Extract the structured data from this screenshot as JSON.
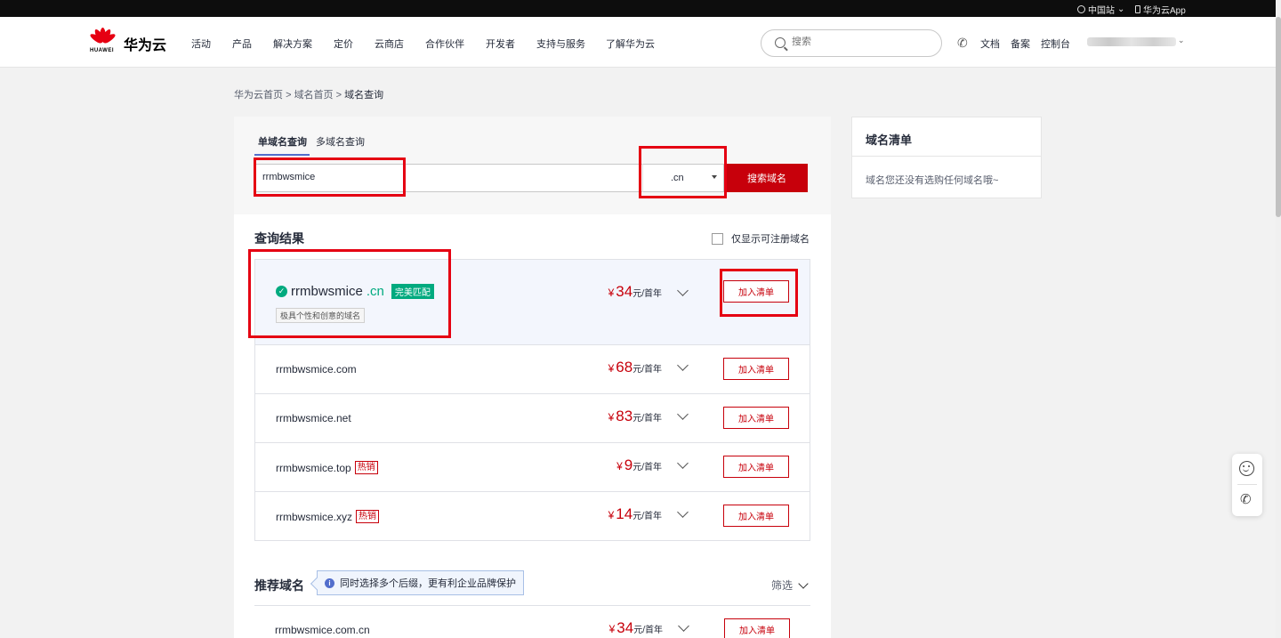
{
  "topbar": {
    "region": "中国站",
    "app": "华为云App"
  },
  "header": {
    "brand_word": "HUAWEI",
    "brand_name": "华为云",
    "nav": [
      "活动",
      "产品",
      "解决方案",
      "定价",
      "云商店",
      "合作伙伴",
      "开发者",
      "支持与服务",
      "了解华为云"
    ],
    "search_placeholder": "搜索",
    "links": {
      "docs": "文档",
      "record": "备案",
      "console": "控制台"
    }
  },
  "breadcrumb": {
    "home": "华为云首页",
    "sep": ">",
    "domain_home": "域名首页",
    "current": "域名查询"
  },
  "query": {
    "tabs": [
      "单域名查询",
      "多域名查询"
    ],
    "input_value": "rrmbwsmice",
    "suffix": ".cn",
    "search_button": "搜索域名"
  },
  "results": {
    "title": "查询结果",
    "only_available": "仅显示可注册域名",
    "featured": {
      "name": "rrmbwsmice",
      "ext": ".cn",
      "match_badge": "完美匹配",
      "description": "极具个性和创意的域名",
      "price": "34",
      "unit": "元/首年",
      "button": "加入清单"
    },
    "rows": [
      {
        "domain": "rrmbwsmice.com",
        "hot": "",
        "price": "68",
        "unit": "元/首年",
        "button": "加入清单"
      },
      {
        "domain": "rrmbwsmice.net",
        "hot": "",
        "price": "83",
        "unit": "元/首年",
        "button": "加入清单"
      },
      {
        "domain": "rrmbwsmice.top",
        "hot": "热销",
        "price": "9",
        "unit": "元/首年",
        "button": "加入清单"
      },
      {
        "domain": "rrmbwsmice.xyz",
        "hot": "热销",
        "price": "14",
        "unit": "元/首年",
        "button": "加入清单"
      }
    ],
    "currency": "¥"
  },
  "recommend": {
    "title": "推荐域名",
    "tip": "同时选择多个后缀，更有利企业品牌保护",
    "filter": "筛选",
    "rows": [
      {
        "domain": "rrmbwsmice.com.cn",
        "price": "34",
        "unit": "元/首年",
        "button": "加入清单"
      }
    ]
  },
  "cart": {
    "title": "域名清单",
    "empty_text": "域名您还没有选购任何域名哦~"
  },
  "colors": {
    "brand_red": "#c7000b",
    "success_green": "#00aa7f",
    "annotation_red": "#e50012",
    "link_blue": "#526ecc"
  },
  "icons": [
    "globe-icon",
    "phone-icon",
    "search-icon",
    "check-circle-icon",
    "chevron-down-icon",
    "info-icon",
    "smile-icon"
  ]
}
